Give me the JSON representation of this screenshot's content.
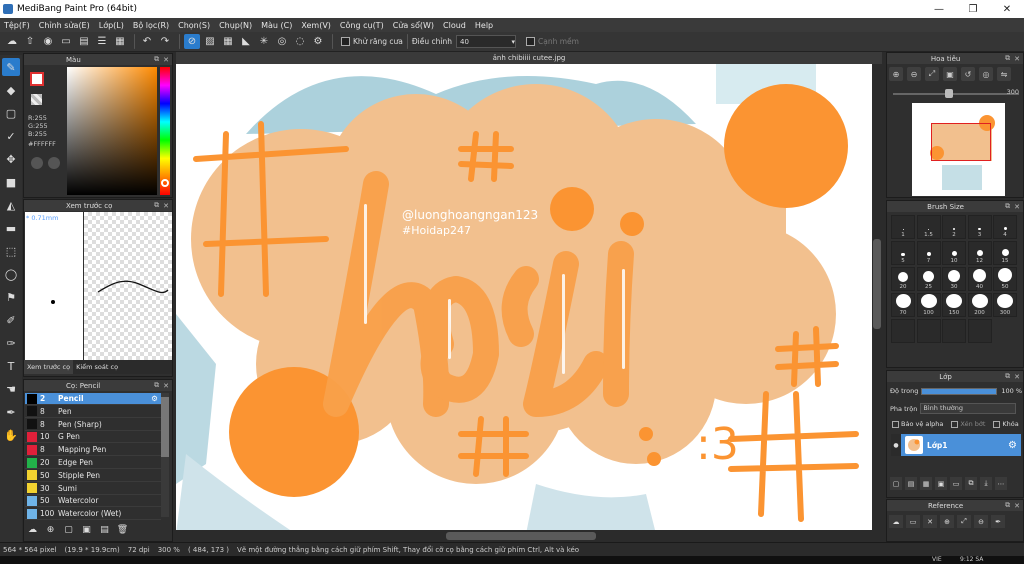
{
  "window": {
    "title": "MediBang Paint Pro (64bit)",
    "min_glyph": "—",
    "max_glyph": "❐",
    "close_glyph": "✕"
  },
  "menu": [
    "Tệp(F)",
    "Chỉnh sửa(E)",
    "Lớp(L)",
    "Bộ lọc(R)",
    "Chọn(S)",
    "Chụp(N)",
    "Màu (C)",
    "Xem(V)",
    "Công cụ(T)",
    "Cửa sổ(W)",
    "Cloud",
    "Help"
  ],
  "toolbar": {
    "antialias_label": "Khử răng cưa",
    "correction_label": "Điều chỉnh",
    "correction_value": "40",
    "sharp_edge_label": "Cạnh mềm"
  },
  "color_panel": {
    "title": "Màu",
    "r": "R:255",
    "g": "G:255",
    "b": "B:255",
    "hex": "#FFFFFF"
  },
  "brush_preview": {
    "title": "Xem trước cọ",
    "size": "* 0.71mm",
    "tab_preview": "Xem trước cọ",
    "tab_control": "Kiểm soát cọ"
  },
  "brush_list": {
    "title": "Cọ: Pencil",
    "items": [
      {
        "size": "2",
        "name": "Pencil",
        "color": "#000000"
      },
      {
        "size": "8",
        "name": "Pen",
        "color": "#111111"
      },
      {
        "size": "8",
        "name": "Pen (Sharp)",
        "color": "#111111"
      },
      {
        "size": "10",
        "name": "G Pen",
        "color": "#e0203a"
      },
      {
        "size": "8",
        "name": "Mapping Pen",
        "color": "#e0203a"
      },
      {
        "size": "20",
        "name": "Edge Pen",
        "color": "#22b24a"
      },
      {
        "size": "50",
        "name": "Stipple Pen",
        "color": "#f2d230"
      },
      {
        "size": "30",
        "name": "Sumi",
        "color": "#f2d230"
      },
      {
        "size": "50",
        "name": "Watercolor",
        "color": "#6fb4e8"
      },
      {
        "size": "100",
        "name": "Watercolor (Wet)",
        "color": "#6fb4e8"
      }
    ]
  },
  "canvas": {
    "tab_title": "ảnh chibiiii cutee.jpg",
    "watermark_line1": "@luonghoangngan123",
    "watermark_line2": "#Hoidap247",
    "lettering": "hỏi",
    "suffix": ":3"
  },
  "navigator": {
    "title": "Hoa tiêu",
    "zoom": "300"
  },
  "brush_size": {
    "title": "Brush Size",
    "sizes": [
      "1",
      "1.5",
      "2",
      "3",
      "4",
      "5",
      "7",
      "10",
      "12",
      "15",
      "20",
      "25",
      "30",
      "40",
      "50",
      "70",
      "100",
      "150",
      "200",
      "300",
      "",
      "",
      "",
      ""
    ]
  },
  "layer_panel": {
    "title": "Lớp",
    "opacity_label": "Độ trong",
    "opacity_value": "100 %",
    "blend_label": "Pha trộn",
    "blend_value": "Bình thường",
    "protect_alpha": "Bảo vệ alpha",
    "clip": "Xén bớt",
    "lock": "Khóa",
    "layer_name": "Lớp1"
  },
  "reference": {
    "title": "Reference"
  },
  "status": {
    "size": "564 * 564 pixel",
    "cm": "(19.9 * 19.9cm)",
    "dpi": "72 dpi",
    "zoom": "300 %",
    "coords": "( 484, 173 )",
    "hint": "Vẽ một đường thẳng bằng cách giữ phím Shift, Thay đổi cỡ cọ bằng cách giữ phím Ctrl, Alt và kéo"
  },
  "taskbar": {
    "lang": "VIE",
    "time": "9:12 SA"
  },
  "colors": {
    "accent": "#2a7ccc",
    "peach": "#f2c08e",
    "orange": "#fb9432",
    "light_orange": "#f9a04a"
  }
}
